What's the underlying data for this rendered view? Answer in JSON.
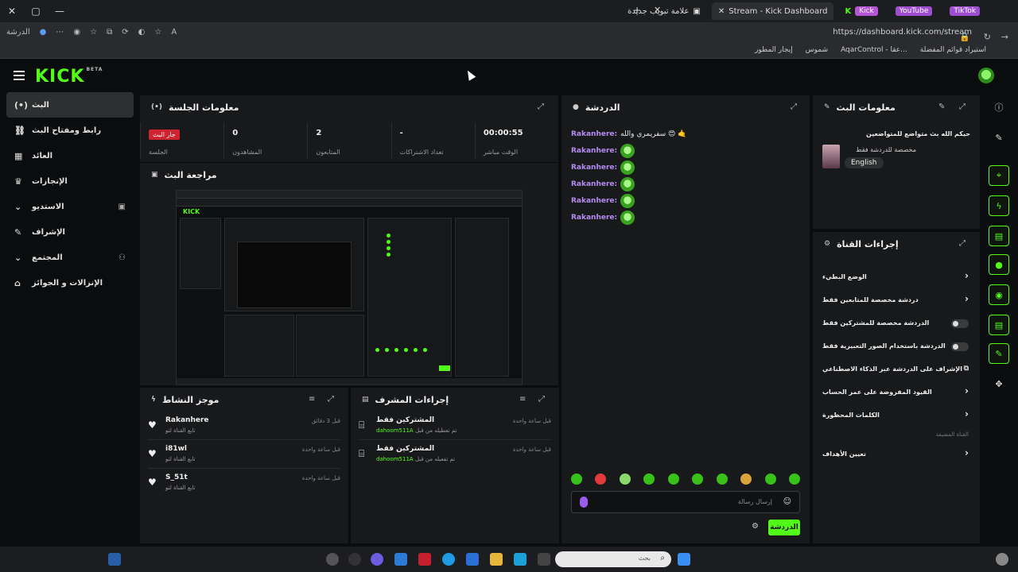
{
  "browser": {
    "tabs": [
      {
        "label": "TikTok",
        "color": "#b455d6"
      },
      {
        "label": "YouTube",
        "color": "#b455d6"
      },
      {
        "label": "Kick",
        "color": "#b455d6"
      },
      {
        "label": "Stream - Kick Dashboard",
        "active": true
      },
      {
        "label": "علامة تبويب جديدة"
      }
    ],
    "url": "https://dashboard.kick.com/stream",
    "left_label": "الدرشة",
    "bookmarks": [
      "استيراد قوائم المفضلة",
      "AqarControl - عقا...",
      "شموس",
      "إيجار المطور"
    ]
  },
  "header": {
    "logo": "KICK",
    "logo_sup": "BETA"
  },
  "nav": {
    "items": [
      {
        "label": "البث",
        "icon": "(•)"
      },
      {
        "label": "رابط ومفتاح البث",
        "icon": "⛓"
      },
      {
        "label": "العائد",
        "icon": "▦"
      },
      {
        "label": "الإنجازات",
        "icon": "🏆"
      },
      {
        "label": "الاستديو",
        "icon": "⌄"
      },
      {
        "label": "الإشراف",
        "icon": "🔧"
      },
      {
        "label": "المجتمع",
        "icon": "⌄"
      },
      {
        "label": "الإنزالات و الجوائز",
        "icon": "⌂"
      }
    ]
  },
  "session": {
    "title": "معلومات الجلسة",
    "stats": [
      {
        "value": "00:00:55",
        "label": "الوقت مباشر"
      },
      {
        "value": "-",
        "label": "تعداد الاشتراكات"
      },
      {
        "value": "2",
        "label": "المتابعون"
      },
      {
        "value": "0",
        "label": "المشاهدون"
      },
      {
        "badge": "جار البث",
        "label": "الجلسة"
      }
    ]
  },
  "preview": {
    "title": "مراجعة البث"
  },
  "activity": {
    "title": "موجز النشاط",
    "items": [
      {
        "name": "Rakanhere",
        "sub": "تابع القناة لتو",
        "time": "قبل 3 دقائق"
      },
      {
        "name": "i81wl",
        "sub": "تابع القناة لتو",
        "time": "قبل ساعة واحدة"
      },
      {
        "name": "S_51t",
        "sub": "تابع القناة لتو",
        "time": "قبل ساعة واحدة"
      }
    ]
  },
  "mod": {
    "title": "إجراءات المشرف",
    "items": [
      {
        "name": "المشتركين فقط",
        "sub": "تم تعطيله من قبل",
        "user": "dahoom511A",
        "time": "قبل ساعة واحدة"
      },
      {
        "name": "المشتركين فقط",
        "sub": "تم تفعيله من قبل",
        "user": "dahoom511A",
        "time": "قبل ساعة واحدة"
      }
    ]
  },
  "chat": {
    "title": "الدردشة",
    "messages": [
      {
        "user": "Rakanhere:",
        "text": "سفريمري والله 😍 🤙"
      },
      {
        "user": "Rakanhere:",
        "text": ""
      },
      {
        "user": "Rakanhere:",
        "text": ""
      },
      {
        "user": "Rakanhere:",
        "text": ""
      },
      {
        "user": "Rakanhere:",
        "text": ""
      },
      {
        "user": "Rakanhere:",
        "text": ""
      }
    ],
    "placeholder": "إرسال رسالة",
    "send_label": "الدردشة"
  },
  "stream_info": {
    "title": "معلومات البث",
    "stream_title": "حيكم الله بث متواضع للمتواضعين",
    "category": "مخصصة للدردشة فقط",
    "language": "English"
  },
  "channel_actions": {
    "title": "إجراءات القناة",
    "items": [
      {
        "label": "الوضع البطيء",
        "type": "chevron"
      },
      {
        "label": "دردشة مخصصة للمتابعين فقط",
        "type": "chevron"
      },
      {
        "label": "الدردشة مخصصة للمشتركين فقط",
        "type": "toggle"
      },
      {
        "label": "الدردشة باستخدام الصور التعبيرية فقط",
        "type": "toggle"
      },
      {
        "label": "الإشراف على الدردشة عبر الذكاء الاصطناعي",
        "type": "external"
      },
      {
        "label": "القيود المفروضة على عمر الحساب",
        "type": "chevron"
      },
      {
        "label": "الكلمات المحظورة",
        "type": "chevron"
      }
    ],
    "section_label": "القناة المضيفة",
    "targets": "تعيين الأهداف"
  },
  "taskbar": {
    "search_placeholder": "بحث"
  },
  "colors": {
    "accent": "#53fc18",
    "live": "#d1222f",
    "username": "#b48cf2"
  }
}
